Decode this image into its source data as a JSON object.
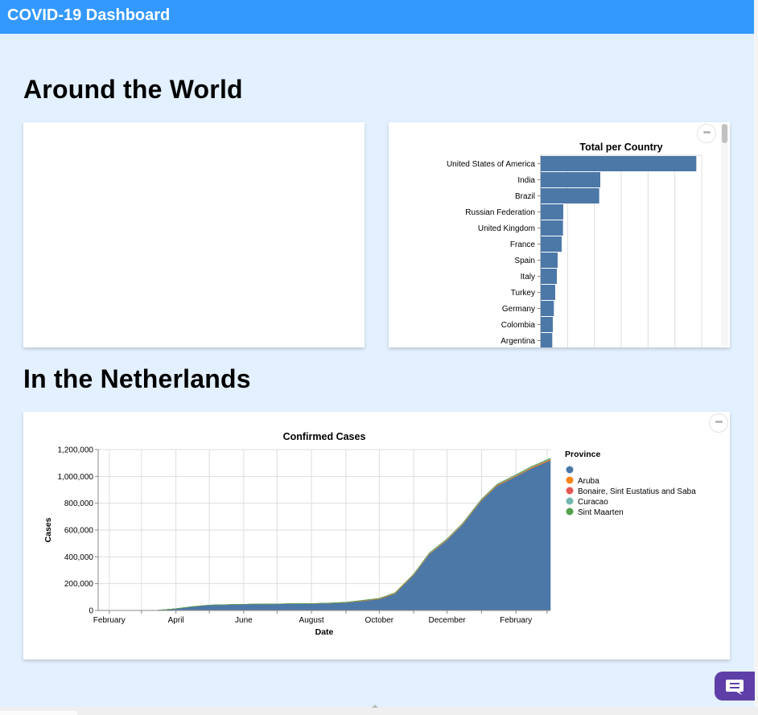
{
  "app": {
    "title": "COVID-19 Dashboard"
  },
  "sections": {
    "world": "Around the World",
    "netherlands": "In the Netherlands"
  },
  "menu_glyph": "•••",
  "colors": {
    "topbar": "#3399ff",
    "page_bg": "#e3f0ff",
    "bar": "#4c78a8",
    "chat": "#5e3fa8"
  },
  "chart_data": [
    {
      "type": "bar",
      "title": "Total per Country",
      "orientation": "horizontal",
      "categories": [
        "United States of America",
        "India",
        "Brazil",
        "Russian Federation",
        "United Kingdom",
        "France",
        "Spain",
        "Italy",
        "Turkey",
        "Germany",
        "Colombia",
        "Argentina"
      ],
      "values": [
        29000000,
        11100000,
        10900000,
        4200000,
        4150000,
        3900000,
        3150000,
        3000000,
        2700000,
        2450000,
        2250000,
        2150000
      ],
      "xlim": [
        0,
        30000000
      ],
      "grid": true
    },
    {
      "type": "area",
      "title": "Confirmed Cases",
      "xlabel": "Date",
      "ylabel": "Cases",
      "stacked": true,
      "x_tick_labels": [
        "February",
        "April",
        "June",
        "August",
        "October",
        "December",
        "February"
      ],
      "y_tick_labels": [
        "0",
        "200,000",
        "400,000",
        "600,000",
        "800,000",
        "1,000,000",
        "1,200,000"
      ],
      "ylim": [
        0,
        1200000
      ],
      "legend": {
        "title": "Province",
        "placement": "right",
        "entries": [
          {
            "name": "",
            "color": "#4c78a8"
          },
          {
            "name": "Aruba",
            "color": "#f58518"
          },
          {
            "name": "Bonaire, Sint Eustatius and Saba",
            "color": "#e45756"
          },
          {
            "name": "Curacao",
            "color": "#72b7b2"
          },
          {
            "name": "Sint Maarten",
            "color": "#54a24b"
          }
        ]
      },
      "x": [
        "2020-01-22",
        "2020-02-15",
        "2020-03-01",
        "2020-03-15",
        "2020-04-01",
        "2020-04-15",
        "2020-05-01",
        "2020-05-15",
        "2020-06-01",
        "2020-06-15",
        "2020-07-01",
        "2020-07-15",
        "2020-08-01",
        "2020-08-15",
        "2020-09-01",
        "2020-09-15",
        "2020-10-01",
        "2020-10-15",
        "2020-11-01",
        "2020-11-15",
        "2020-12-01",
        "2020-12-15",
        "2021-01-01",
        "2021-01-15",
        "2021-02-01",
        "2021-02-15",
        "2021-03-04"
      ],
      "series": [
        {
          "name": "",
          "color": "#4c78a8",
          "values": [
            0,
            0,
            0,
            1500,
            13000,
            28000,
            40000,
            43000,
            46000,
            48000,
            49000,
            50000,
            51000,
            53000,
            58000,
            70000,
            85000,
            125000,
            265000,
            420000,
            525000,
            640000,
            820000,
            930000,
            1000000,
            1060000,
            1120000
          ]
        },
        {
          "name": "Aruba",
          "color": "#f58518",
          "values": [
            0,
            0,
            0,
            0,
            50,
            97,
            100,
            101,
            101,
            102,
            105,
            120,
            600,
            1200,
            2500,
            3500,
            4200,
            4500,
            4600,
            4900,
            5100,
            5400,
            5600,
            6000,
            6400,
            7000,
            7600
          ]
        },
        {
          "name": "Bonaire, Sint Eustatius and Saba",
          "color": "#e45756",
          "values": [
            0,
            0,
            0,
            0,
            2,
            5,
            7,
            7,
            7,
            7,
            13,
            15,
            20,
            30,
            40,
            120,
            160,
            170,
            180,
            190,
            200,
            240,
            300,
            400,
            600,
            1000,
            1400
          ]
        },
        {
          "name": "Curacao",
          "color": "#72b7b2",
          "values": [
            0,
            0,
            0,
            0,
            11,
            14,
            16,
            16,
            18,
            20,
            25,
            30,
            70,
            200,
            300,
            500,
            800,
            1600,
            3100,
            4100,
            4400,
            4500,
            4600,
            4700,
            4800,
            4900,
            5000
          ]
        },
        {
          "name": "Sint Maarten",
          "color": "#54a24b",
          "values": [
            0,
            0,
            0,
            0,
            10,
            60,
            76,
            77,
            77,
            77,
            78,
            150,
            450,
            600,
            700,
            750,
            800,
            850,
            880,
            900,
            1200,
            1350,
            1550,
            1700,
            1850,
            1950,
            2000
          ]
        }
      ]
    }
  ]
}
